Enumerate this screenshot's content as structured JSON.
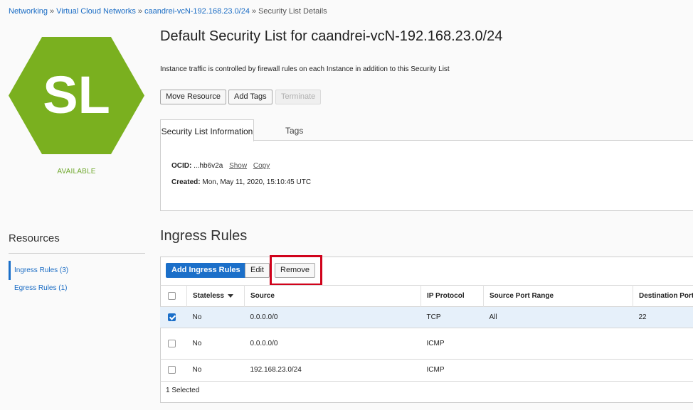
{
  "breadcrumb": {
    "items": [
      "Networking",
      "Virtual Cloud Networks",
      "caandrei-vcN-192.168.23.0/24"
    ],
    "current": "Security List Details",
    "separator": "»"
  },
  "resource_badge": {
    "initials": "SL",
    "status": "AVAILABLE",
    "color": "#7ab01f",
    "status_color": "#6fa82d"
  },
  "header": {
    "title": "Default Security List for caandrei-vcN-192.168.23.0/24",
    "description": "Instance traffic is controlled by firewall rules on each Instance in addition to this Security List"
  },
  "actions": {
    "move": "Move Resource",
    "tags": "Add Tags",
    "terminate": "Terminate"
  },
  "info_tabs": {
    "info": "Security List Information",
    "tags": "Tags"
  },
  "info": {
    "ocid_label": "OCID:",
    "ocid_value": "...hb6v2a",
    "show": "Show",
    "copy": "Copy",
    "created_label": "Created:",
    "created_value": "Mon, May 11, 2020, 15:10:45 UTC"
  },
  "resources": {
    "title": "Resources",
    "items": [
      {
        "label": "Ingress Rules (3)"
      },
      {
        "label": "Egress Rules (1)"
      }
    ]
  },
  "ingress": {
    "title": "Ingress Rules",
    "add_button": "Add Ingress Rules",
    "edit_button": "Edit",
    "remove_button": "Remove",
    "columns": [
      "Stateless",
      "Source",
      "IP Protocol",
      "Source Port Range",
      "Destination Port"
    ],
    "rows": [
      {
        "stateless": "No",
        "source": "0.0.0.0/0",
        "protocol": "TCP",
        "source_port": "All",
        "dest_port": "22",
        "selected": true
      },
      {
        "stateless": "No",
        "source": "0.0.0.0/0",
        "protocol": "ICMP",
        "source_port": "",
        "dest_port": "",
        "selected": false
      },
      {
        "stateless": "No",
        "source": "192.168.23.0/24",
        "protocol": "ICMP",
        "source_port": "",
        "dest_port": "",
        "selected": false
      }
    ],
    "footer": "1 Selected"
  },
  "colors": {
    "accent": "#1b6fc9",
    "highlight": "#d0021b",
    "selected_row": "#e6f0fa"
  }
}
